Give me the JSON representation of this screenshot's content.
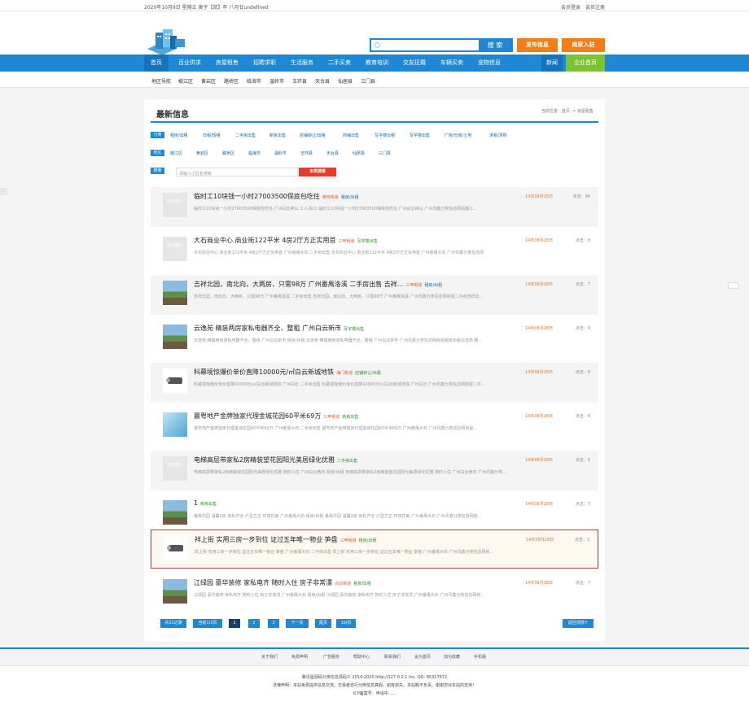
{
  "topbar": {
    "date": "2020年10月9日 星期五 庚子【鼠】年 八月廿undefined",
    "login": "会员登录",
    "register": "会员注册"
  },
  "header": {
    "search_btn": "搜 索",
    "publish": "发布信息",
    "join": "商家入驻"
  },
  "nav": [
    "首页",
    "百业供求",
    "房屋租售",
    "招聘求职",
    "生活服务",
    "二手买卖",
    "教育培训",
    "交友征婚",
    "车辆买卖",
    "宠物信息",
    "新闻",
    "企业首页"
  ],
  "subnav": [
    "地区导航",
    "椒江区",
    "黄岩区",
    "路桥区",
    "临海市",
    "温岭市",
    "玉环县",
    "天台县",
    "仙居县",
    "三门县"
  ],
  "panel": {
    "title": "最新信息",
    "breadcrumb": "当前位置：首页 -> 房屋租售"
  },
  "filters": {
    "cat_tag": "分类",
    "cats": [
      "租房/出租",
      "日租/短租",
      "二手房出售",
      "新房出售",
      "店铺转让/出租",
      "商铺出售",
      "写字楼出租",
      "写字楼出售",
      "厂房/仓库/土地",
      "求租/求购"
    ],
    "area_tag": "地区",
    "areas": [
      "椒江区",
      "黄岩区",
      "路桥区",
      "临海市",
      "温岭市",
      "玉环县",
      "天台县",
      "仙居县",
      "三门县"
    ],
    "search_tag": "搜索",
    "search_placeholder": "请输入小区名搜索",
    "search_btn": "本类搜索"
  },
  "no_image": "暂无图片",
  "items": [
    {
      "title": "临时工10块钱一小时27003500保底包吃住",
      "tags": [
        [
          "黄安街道",
          "r"
        ],
        [
          "租房/出租",
          "b"
        ]
      ],
      "date": "14年08月28日",
      "views": "点击：94",
      "desc": "临时工10块钱一小时27003500保底包吃住 广州白云神山 工人/杂工 临时工10块钱一小时27003500保底包吃住 广州白云神山 广州讯鑫分类信息网站搬工..."
    },
    {
      "title": "大石商业中心 商业街122平米 4房2厅方正实用首",
      "tags": [
        [
          "三甲街道",
          "r"
        ],
        [
          "写字楼出售",
          "n"
        ]
      ],
      "date": "14年08月28日",
      "views": "点击：8",
      "desc": "大石商业中心 商业街122平米 4房2厅方正实用首 广州番禺大石 二手房出售 大石商业中心 商业街122平米 4房2厅方正实用首 广州番禺大石 广州讯鑫分类信息网"
    },
    {
      "title": "吉祥北园，南北向，大两房，只需98万 广州番禺洛溪 二手房出售 吉祥...",
      "tags": [
        [
          "三甲街道",
          "r"
        ],
        [
          "租房/出租",
          "b"
        ]
      ],
      "date": "14年08月28日",
      "views": "点击：7",
      "desc": "吉祥北园，南北向，大两房，只需98万 广州番禺洛溪 二手房出售 吉祥北园，南北向，大两房，只需98万 广州番禺洛溪 广州讯鑫分类信息网房屋二手房吉祥北..."
    },
    {
      "title": "云逸苑 精装两房家私电器齐全，整租 广州白云新市",
      "tags": [
        [
          "写字楼出售",
          "n"
        ]
      ],
      "date": "14年08月28日",
      "views": "点击：6",
      "desc": "云逸苑 精装两房家私电器齐全，整租 广州白云新市 租房/出租 云逸苑 精装两房家私电器齐全，整租 广州白云新市 广州讯鑫分类信息网房屋租房出租云逸苑 精..."
    },
    {
      "title": "科幕境惊爆价单价直降10000元/㎡白云新城地铁",
      "tags": [
        [
          "海门街道",
          "r"
        ],
        [
          "店铺转让/出租",
          "n"
        ]
      ],
      "date": "14年08月28日",
      "views": "点击：8",
      "desc": "科幕境惊爆价单价直降10000元/㎡白云新城地铁 广州白云 二手房出售 科幕境惊爆价单价直降10000元/㎡白云新城地铁 广州白云 广州讯鑫分类信息网房屋二手..."
    },
    {
      "title": "晨粤地产金牌独家代理金城花园60平米69万",
      "tags": [
        [
          "三甲街道",
          "r"
        ],
        [
          "新房出售",
          "n"
        ]
      ],
      "date": "14年08月28日",
      "views": "点击：6",
      "desc": "晨粤地产金牌独家代理金城花园60平米69万 广州番禺大石 二手房出售 晨粤地产金牌独家代理金城花园60平米69万 广州番禺大石 广州讯鑫分类信息网房屋..."
    },
    {
      "title": "电梯高层带家私2房精装望花园阳光美居绿化优雅",
      "tags": [
        [
          "二手房出售",
          "n"
        ]
      ],
      "date": "14年08月28日",
      "views": "点击：5",
      "desc": "电梯高层带家私2房精装望花园阳光美居绿化优雅 随时入住 广州白云黄石 租房/出租 电梯高层带家私2房精装望花园阳光美居绿化优雅 随时入住 广州白云黄石 广州讯鑫分类..."
    },
    {
      "title": "1",
      "tags": [
        [
          "新房出售",
          "n"
        ]
      ],
      "date": "14年08月28日",
      "views": "点击：7",
      "desc": "番禺华园 温馨2房 家私齐全 户型方正 环境优美 广州番禺大石 租房/出租 番禺华园 温馨2房 家私齐全 户型方正 环境优美 广州番禺大石 广州讯鑫分类信息网房..."
    },
    {
      "title": "祥上街 实用三房一步到位 证过五年唯一物业 笋盘",
      "tags": [
        [
          "三甲街道",
          "r"
        ],
        [
          "租房/出租",
          "n"
        ]
      ],
      "date": "14年08月28日",
      "views": "点击：3",
      "desc": "祥上街 实用三房一步到位 证过五年唯一物业 笋盘 广州番禺大石 二手房出售 祥上街 实用三房一步到位 证过五年唯一物业 笋盘 广州番禺大石 广州讯鑫分类信息网房..."
    },
    {
      "title": "江绿园 豪华装修 家私电齐 随时入住 房子非常漂",
      "tags": [
        [
          "白云街道",
          "r"
        ],
        [
          "租房/出租",
          "n"
        ]
      ],
      "date": "14年08月28日",
      "views": "点击：7",
      "desc": "江绿园 豪华装修 家私电齐 随时入住 房子非常漂 广州番禺大石 租房/出租 江绿园 豪华装修 家私电齐 随时入住 房子非常漂 广州番禺大石 广州讯鑫分类信息网房..."
    }
  ],
  "pagination": {
    "total": "共21记录",
    "current": "当前1/3页",
    "pages": [
      "1",
      "2",
      "3"
    ],
    "next": "下一页",
    "last": "尾页",
    "pageof": "10/页",
    "back": "返回顶部↑"
  },
  "footer": {
    "links": [
      "关于我们",
      "免费声明",
      "广告服务",
      "帮助中心",
      "联系我们",
      "设为首页",
      "加为收藏",
      "手机版"
    ],
    "copyright": "聚讯屋源码分类信息源码© 2014-2020 http://127.0.0.1 Inc. QQ: 85317672",
    "statement": "法律声明：本站免费提供信息交流。交易者自行分辨信息真假。如有损失，本站概不负责。谢谢您对本站的支持！",
    "icp": "ICP备案号：申请中......"
  },
  "colors": {
    "primary": "#1e88d4",
    "orange": "#f57d16",
    "green": "#7cc233",
    "red": "#e53c2c"
  }
}
